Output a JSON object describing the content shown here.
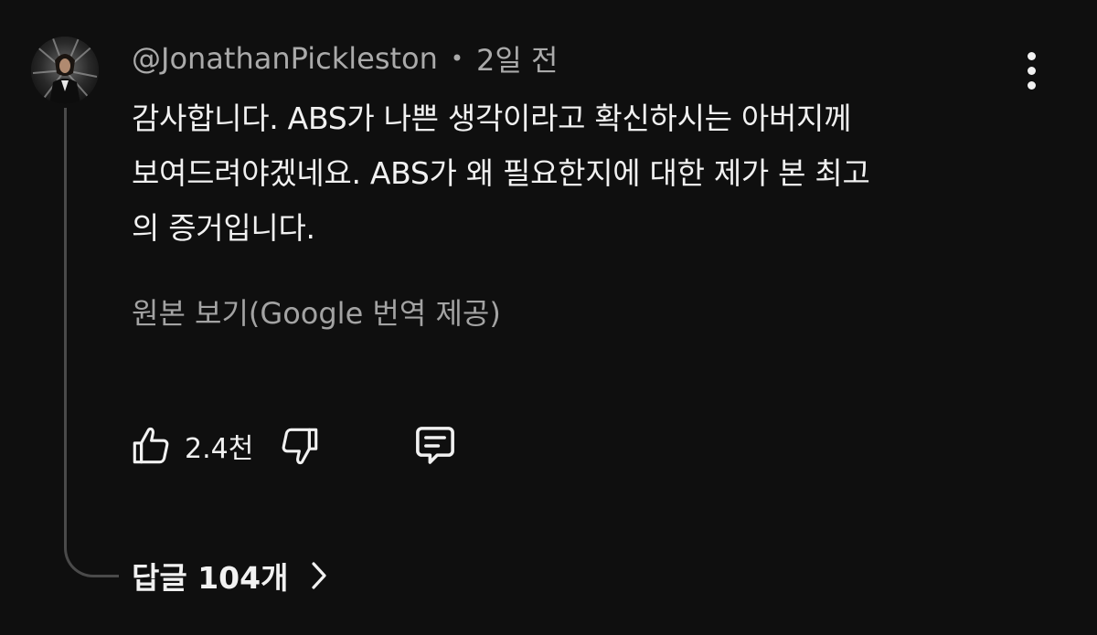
{
  "comment": {
    "author": "@JonathanPickleston",
    "separator": "•",
    "time": "2일 전",
    "text_lines": [
      "감사합니다. ABS가 나쁜 생각이라고 확신하시는 아버지께",
      "보여드려야겠네요. ABS가 왜 필요한지에 대한 제가 본 최고",
      "의 증거입니다."
    ],
    "translate_label": "원본 보기(Google 번역 제공)",
    "like_count": "2.4천",
    "replies_label": "답글 104개"
  },
  "icons": {
    "avatar": "user-avatar",
    "more": "more-vertical-icon",
    "like": "thumbs-up-icon",
    "dislike": "thumbs-down-icon",
    "reply": "comment-reply-icon",
    "chevron": "chevron-right-icon"
  },
  "colors": {
    "background": "#0f0f0f",
    "primary_text": "#f1f1f1",
    "secondary_text": "#aaaaaa",
    "thread_line": "#4a4a4a"
  }
}
